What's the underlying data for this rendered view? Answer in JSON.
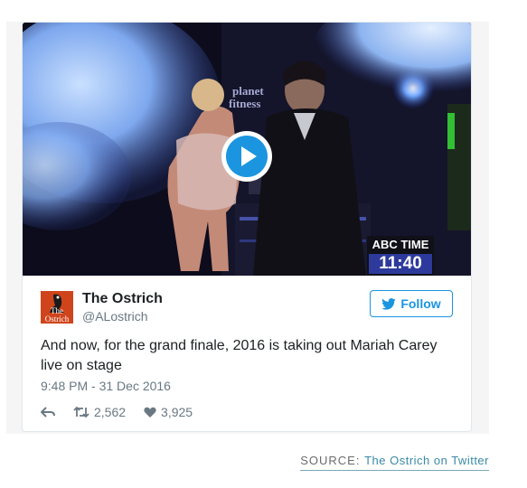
{
  "tweet": {
    "author_name": "The Ostrich",
    "author_handle": "@ALostrich",
    "avatar_text": "The\nOstrich",
    "follow_label": "Follow",
    "text": "And now, for the grand finale, 2016 is taking out Mariah Carey live on stage",
    "date": "9:48 PM - 31 Dec 2016",
    "retweets": "2,562",
    "likes": "3,925",
    "accent_color": "#1b95e0"
  },
  "media": {
    "badge_label": "ABC TIME",
    "badge_time": "11:40",
    "sign_text": "planet fitness",
    "play_icon": "play-icon"
  },
  "source": {
    "label": "SOURCE:",
    "link": "The Ostrich on Twitter"
  }
}
